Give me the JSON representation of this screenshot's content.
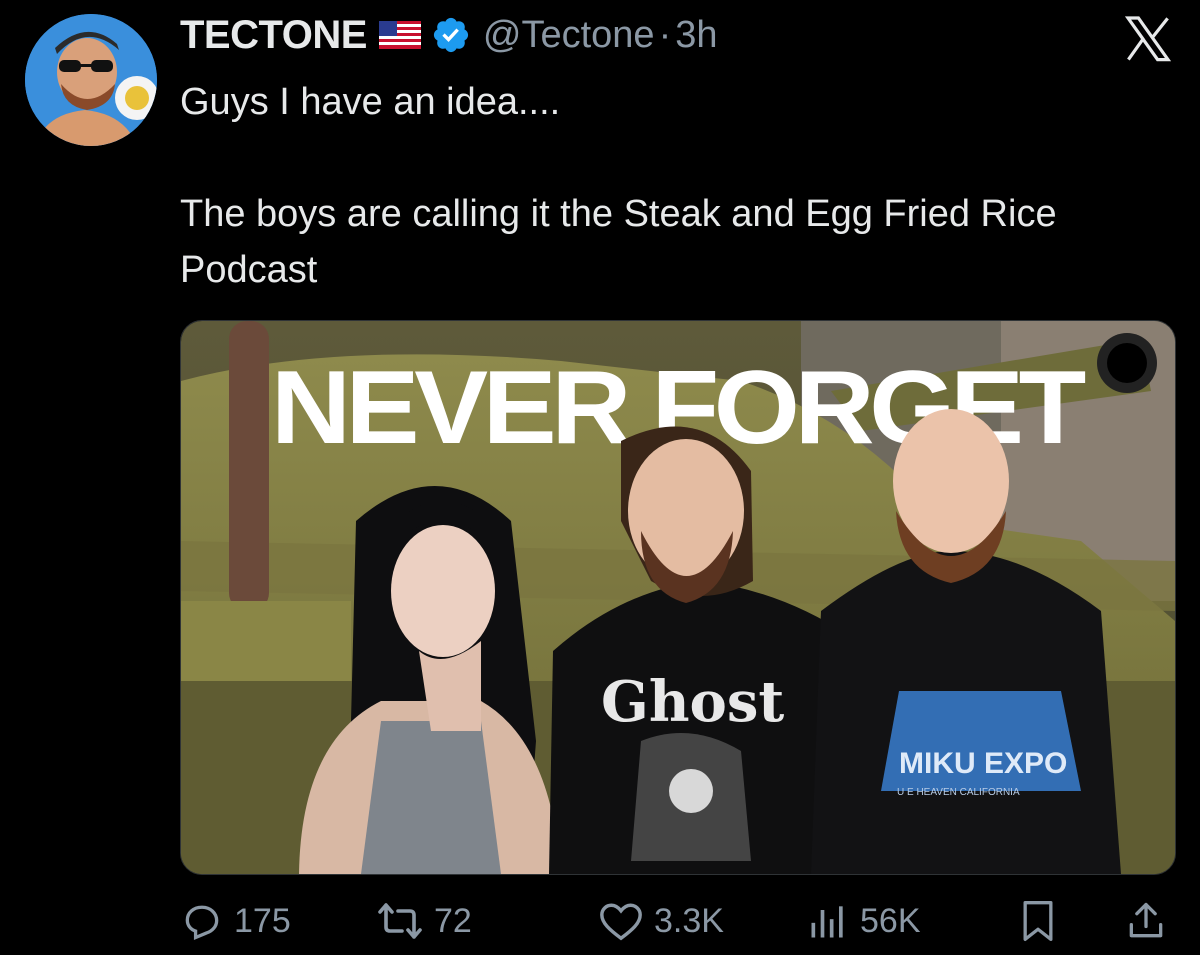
{
  "tweet": {
    "author_name": "TECTONE",
    "handle": "@Tectone",
    "separator": "·",
    "time": "3h",
    "text_line1": "Guys I have an idea....",
    "text_line2": "The boys are calling it the Steak and Egg Fried Rice Podcast"
  },
  "media": {
    "headline": "NEVER FORGET",
    "shirt_band": "Ghost",
    "hoodie_title": "MIKU EXPO",
    "hoodie_subtitle": "U E  HEAVEN  CALIFORNIA"
  },
  "actions": {
    "replies": "175",
    "reposts": "72",
    "likes": "3.3K",
    "views": "56K"
  },
  "colors": {
    "background": "#000000",
    "text": "#e7e9ea",
    "muted": "#8b98a5",
    "verified": "#1d9bf0"
  },
  "icons": [
    "verified-badge-icon",
    "us-flag-icon",
    "x-logo-icon",
    "reply-icon",
    "repost-icon",
    "like-icon",
    "views-icon",
    "bookmark-icon",
    "share-icon"
  ]
}
